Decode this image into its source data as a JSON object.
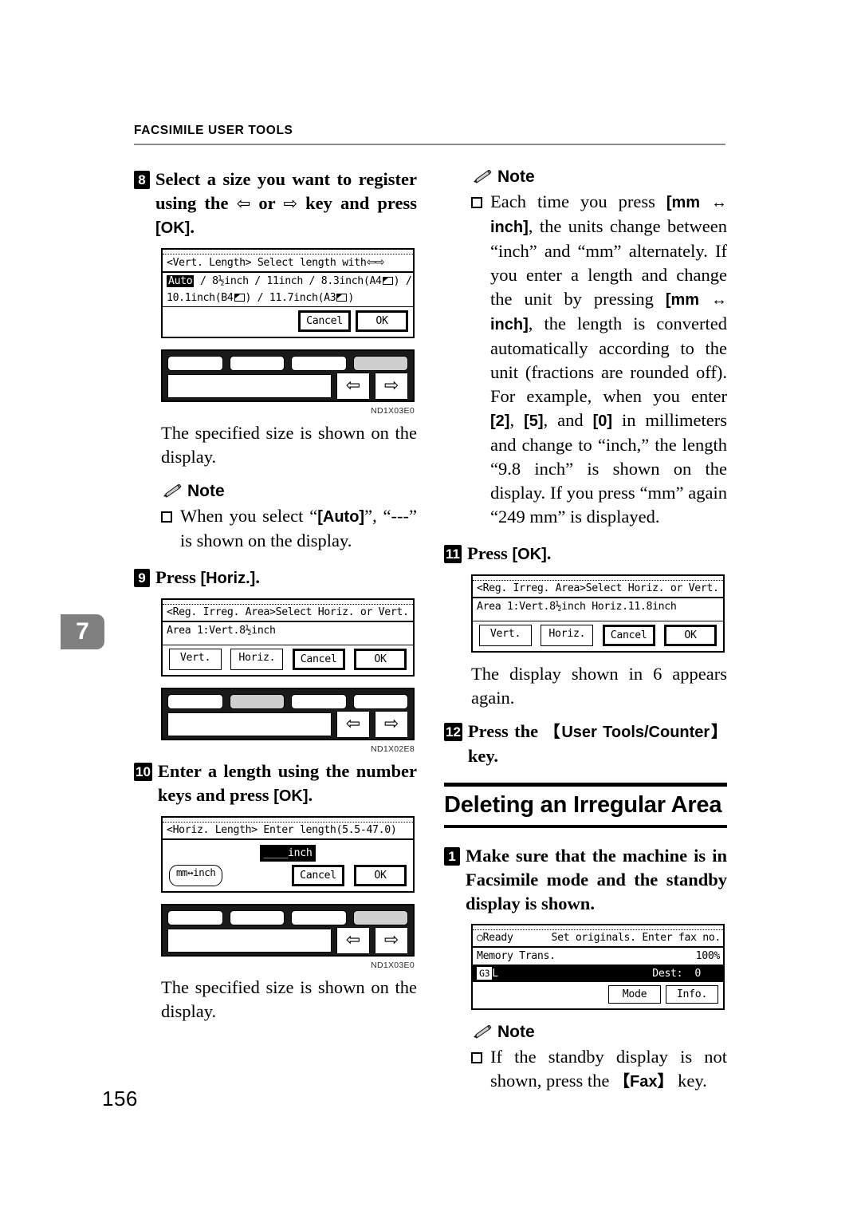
{
  "page": {
    "running_head": "FACSIMILE USER TOOLS",
    "chapter_tab": "7",
    "folio": "156"
  },
  "left_column": {
    "step8": {
      "number": "8",
      "text_part1": "Select a size you want to register using the ",
      "left_arrow": "⇦",
      "or": " or ",
      "right_arrow": "⇨",
      "text_part2": " key and press ",
      "ok_bracket": "[OK]",
      "period": "."
    },
    "lcd_vert_length": {
      "title": "<Vert. Length>    Select length with",
      "title_arrows": "⇦⇨",
      "option_auto": "Auto",
      "line1_rest": " / 8½inch / 11inch / 8.3inch(A4",
      "line1_tail": ") /",
      "line2_a": "10.1inch(B4",
      "line2_b": ") / 11.7inch(A3",
      "line2_c": ")",
      "btn_cancel": "Cancel",
      "btn_ok": "OK"
    },
    "keypad1_figcode": "ND1X03E0",
    "para_specified_size": "The specified size is shown on the display.",
    "note1": {
      "label": "Note",
      "text_a": "When you select “",
      "auto": "[Auto]",
      "text_b": "”, “---” is shown on the display."
    },
    "step9": {
      "number": "9",
      "text_a": "Press ",
      "horiz": "[Horiz.]",
      "text_b": "."
    },
    "lcd_reg_area_1": {
      "title": "<Reg. Irreg. Area>Select Horiz. or Vert.",
      "line1": "Area 1:Vert.8½inch",
      "btn_vert": "Vert.",
      "btn_horiz": "Horiz.",
      "btn_cancel": "Cancel",
      "btn_ok": "OK"
    },
    "keypad2_figcode": "ND1X02E8",
    "step10": {
      "number": "10",
      "text_a": "Enter a length using the number keys and press ",
      "ok_bracket": "[OK]",
      "period": "."
    },
    "lcd_horiz_length": {
      "title": "<Horiz. Length>  Enter length(5.5-47.0)",
      "entry": "____inch",
      "btn_mm_inch": "mm↔inch",
      "btn_cancel": "Cancel",
      "btn_ok": "OK"
    },
    "keypad3_figcode": "ND1X03E0",
    "para_specified_size_2": "The specified size is shown on the display."
  },
  "right_column": {
    "note_units": {
      "label": "Note",
      "seg1": "Each time you press ",
      "mm_inch_1": "[mm ↔ inch]",
      "seg2": ", the units change between “inch” and “mm” alternately. If you enter a length and change the unit by pressing ",
      "mm_inch_2": "[mm ↔ inch]",
      "seg3": ", the length is converted automatically according to the unit (fractions are rounded off). For example, when you enter ",
      "key2": "[2]",
      "seg4": ", ",
      "key5": "[5]",
      "seg5": ", and ",
      "key0": "[0]",
      "seg6": " in millimeters and change to “inch,” the length “9.8 inch” is shown on the display. If you press “mm” again “249 mm” is displayed."
    },
    "step11": {
      "number": "11",
      "text_a": "Press ",
      "ok_bracket": "[OK]",
      "period": "."
    },
    "lcd_reg_area_2": {
      "title": "<Reg. Irreg. Area>Select Horiz. or Vert.",
      "line1": "Area 1:Vert.8½inch   Horiz.11.8inch",
      "btn_vert": "Vert.",
      "btn_horiz": "Horiz.",
      "btn_cancel": "Cancel",
      "btn_ok": "OK"
    },
    "para_display_again": "The display shown in 6 appears again.",
    "step12": {
      "number": "12",
      "text_a": "Press the ",
      "keycap": "【User Tools/Counter】",
      "text_b": " key."
    },
    "section_title": "Deleting an Irregular Area",
    "del_step1": {
      "number": "1",
      "text": "Make sure that the machine is in Facsimile mode and the standby display is shown."
    },
    "lcd_standby": {
      "status_icon": "○",
      "status": "Ready",
      "prompt": "Set originals. Enter fax no.",
      "line2_left": "Memory Trans.",
      "line2_right": "100%",
      "line3_badge": "G3",
      "line3_text": "L",
      "line3_dest_label": "Dest:",
      "line3_dest_value": "0",
      "btn_mode": "Mode",
      "btn_info": "Info."
    },
    "note_standby": {
      "label": "Note",
      "text_a": "If the standby display is not shown, press the ",
      "keycap": "【Fax】",
      "text_b": " key."
    }
  }
}
